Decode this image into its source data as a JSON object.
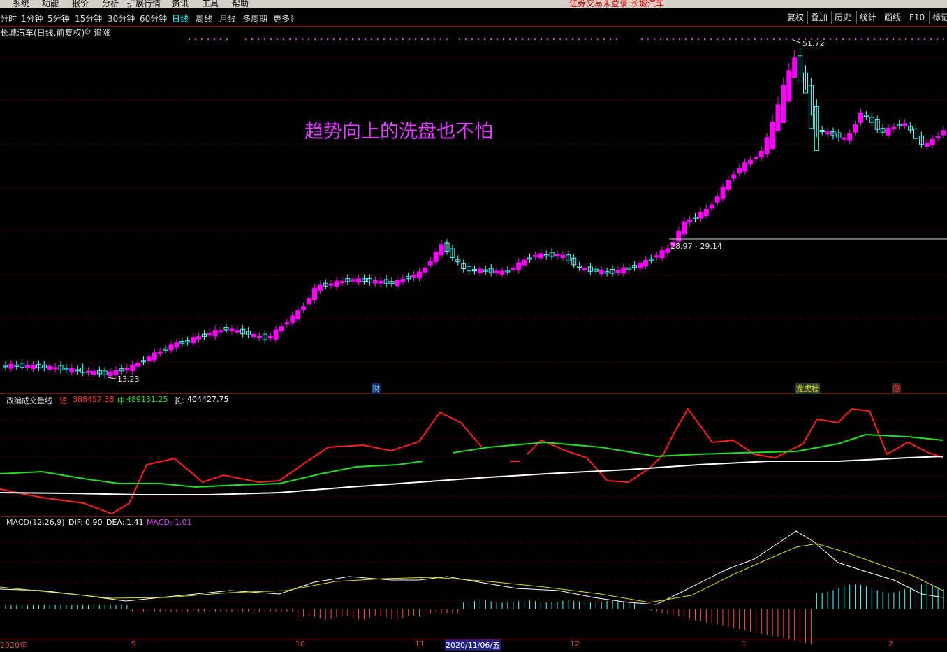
{
  "menubar": {
    "items": [
      "系统",
      "功能",
      "报价",
      "分析",
      "扩展行情",
      "资讯",
      "工具",
      "帮助"
    ],
    "notice": "证券交易未登录  长城汽车"
  },
  "toolbar": {
    "periods": [
      "分时",
      "1分钟",
      "5分钟",
      "15分钟",
      "30分钟",
      "60分钟",
      "日线",
      "周线",
      "月线",
      "多周期",
      "更多》"
    ],
    "active_period": "日线",
    "right_buttons": [
      "复权",
      "叠加",
      "历史",
      "统计",
      "画线",
      "F10",
      "标记"
    ]
  },
  "title": {
    "stock": "长城汽车(日线,前复权)",
    "mode": "追涨"
  },
  "annotation": "趋势向上的洗盘也不怕",
  "price_labels": {
    "high": "51.72",
    "low": "13.23",
    "range": "28.97 - 29.14"
  },
  "event_markers": [
    "财",
    "龙虎榜",
    "涨"
  ],
  "volume_panel": {
    "name": "改编成交量线",
    "short_label": "短:",
    "short_value": "388457.38",
    "mid_label": "中:",
    "mid_value": "489131.25",
    "long_label": "长:",
    "long_value": "404427.75"
  },
  "macd_panel": {
    "name": "MACD(12,26,9)",
    "dif_label": "DIF:",
    "dif_value": "0.90",
    "dea_label": "DEA:",
    "dea_value": "1.41",
    "macd_label": "MACD:",
    "macd_value": "-1.01"
  },
  "date_axis": [
    "2020年",
    "9",
    "10",
    "11",
    "2020/11/06/五",
    "12",
    "1",
    "2"
  ],
  "colors": {
    "up": "#ff00ff",
    "down": "#54ffff",
    "short_line": "#ff2020",
    "mid_line": "#20e020",
    "long_line": "#ffffff",
    "annotation": "#e040ff"
  }
}
